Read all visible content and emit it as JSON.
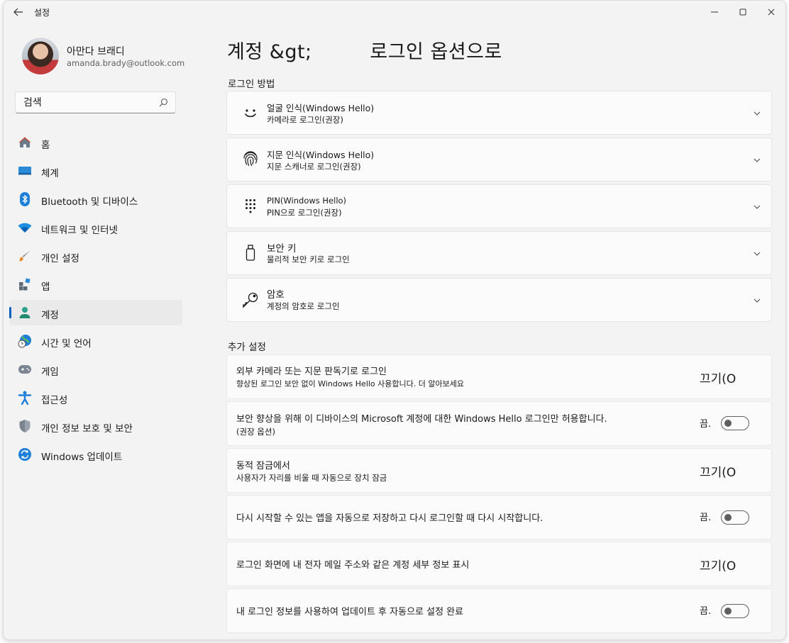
{
  "window": {
    "title": "설정"
  },
  "profile": {
    "name": "아만다 브래디",
    "email": "amanda.brady@outlook.com"
  },
  "search": {
    "placeholder": "검색"
  },
  "nav": [
    {
      "label": "홈",
      "icon": "home-icon",
      "active": false
    },
    {
      "label": "체계",
      "icon": "system-icon",
      "active": false
    },
    {
      "label": "Bluetooth 및 디바이스",
      "icon": "bluetooth-icon",
      "active": false
    },
    {
      "label": "네트워크 및 인터넷",
      "icon": "wifi-icon",
      "active": false
    },
    {
      "label": "개인 설정",
      "icon": "brush-icon",
      "active": false
    },
    {
      "label": "앱",
      "icon": "apps-icon",
      "active": false
    },
    {
      "label": "계정",
      "icon": "account-icon",
      "active": true
    },
    {
      "label": "시간 및 언어",
      "icon": "globe-clock-icon",
      "active": false
    },
    {
      "label": "게임",
      "icon": "gamepad-icon",
      "active": false
    },
    {
      "label": "접근성",
      "icon": "accessibility-icon",
      "active": false
    },
    {
      "label": "개인 정보 보호 및 보안",
      "icon": "shield-icon",
      "active": false
    },
    {
      "label": "Windows 업데이트",
      "icon": "update-icon",
      "active": false
    }
  ],
  "main": {
    "title": "계정 &gt;         로그인 옵션으로",
    "sign_in_methods_label": "로그인 방법",
    "methods": [
      {
        "title": "얼굴 인식(Windows Hello)",
        "subtitle": "카메라로 로그인(권장)",
        "icon": "face-icon"
      },
      {
        "title": "지문 인식(Windows Hello)",
        "subtitle": "지문 스캐너로 로그인(권장)",
        "icon": "fingerprint-icon"
      },
      {
        "title": "PIN(Windows Hello)",
        "subtitle": "PIN으로 로그인(권장)",
        "icon": "pin-keypad-icon"
      },
      {
        "title": "보안 키",
        "subtitle": "물리적 보안 키로 로그인",
        "icon": "usb-key-icon"
      },
      {
        "title": "암호",
        "subtitle": "계정의 암호로 로그인",
        "icon": "key-icon"
      }
    ],
    "additional_label": "추가 설정",
    "settings": [
      {
        "title": "외부 카메라 또는 지문 판독기로 로그인",
        "subtitle": "향상된 로그인 보안 없이 Windows Hello 사용합니다. 더 알아보세요",
        "state_text": "끄기(O",
        "toggle": false
      },
      {
        "title": "보안 향상을 위해 이 디바이스의 Microsoft 계정에 대한 Windows  Hello 로그인만 허용합니다.",
        "subtitle": "(권장 옵션)",
        "state_text": "끔.",
        "toggle": true
      },
      {
        "title": "동적 잠금에서",
        "subtitle": "사용자가 자리를 비울 때 자동으로 장치 잠금",
        "state_text": "끄기(O",
        "toggle": false
      },
      {
        "title": "다시 시작할 수 있는 앱을 자동으로 저장하고 다시 로그인할 때 다시 시작합니다.",
        "subtitle": "",
        "state_text": "끔.",
        "toggle": true
      },
      {
        "title": "로그인 화면에 내 전자 메일 주소와 같은 계정 세부 정보 표시",
        "subtitle": "",
        "state_text": "끄기(O",
        "toggle": false
      },
      {
        "title": "내 로그인 정보를 사용하여 업데이트 후 자동으로 설정 완료",
        "subtitle": "",
        "state_text": "끔.",
        "toggle": true
      }
    ]
  },
  "colors": {
    "accent": "#005fb8",
    "background": "#f3f3f3",
    "card": "#fbfbfb"
  }
}
